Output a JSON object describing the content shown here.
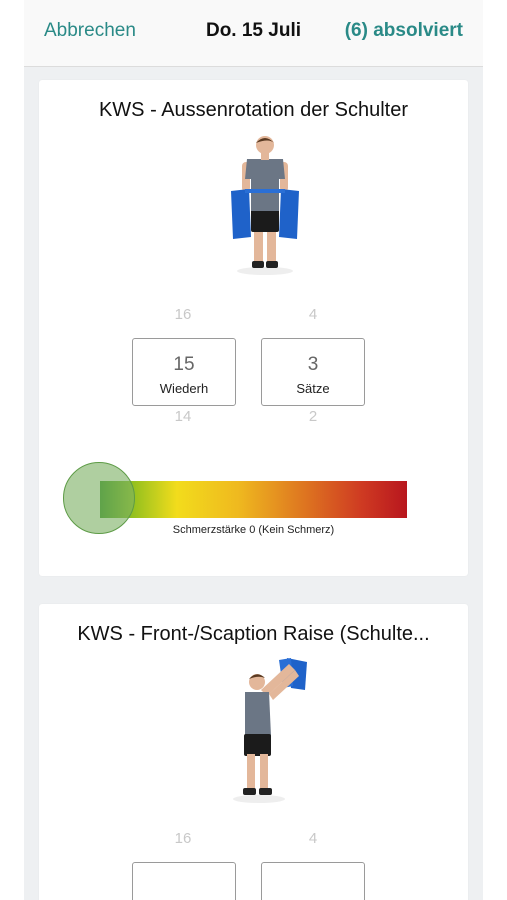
{
  "nav": {
    "cancel_label": "Abbrechen",
    "date_title": "Do. 15 Juli",
    "done_label": "(6) absolviert"
  },
  "exercises": [
    {
      "title": "KWS - Aussenrotation der Schulter",
      "image": "exercise-photo-shoulder-external-rotation-band",
      "reps": {
        "above": "16",
        "value": "15",
        "below": "14",
        "label": "Wiederh"
      },
      "sets": {
        "above": "4",
        "value": "3",
        "below": "2",
        "label": "Sätze"
      },
      "pain": {
        "level": 0,
        "label": "Schmerzstärke 0 (Kein Schmerz)"
      }
    },
    {
      "title": "KWS - Front-/Scaption Raise (Schulte...",
      "image": "exercise-photo-front-scaption-raise-band",
      "reps": {
        "above": "16"
      },
      "sets": {
        "above": "4"
      }
    }
  ],
  "colors": {
    "accent": "#2a8a87",
    "pain_scale": [
      "#2e8b1e",
      "#f2dc1c",
      "#df7a20",
      "#b8161e"
    ],
    "band": "#1f62c9"
  }
}
